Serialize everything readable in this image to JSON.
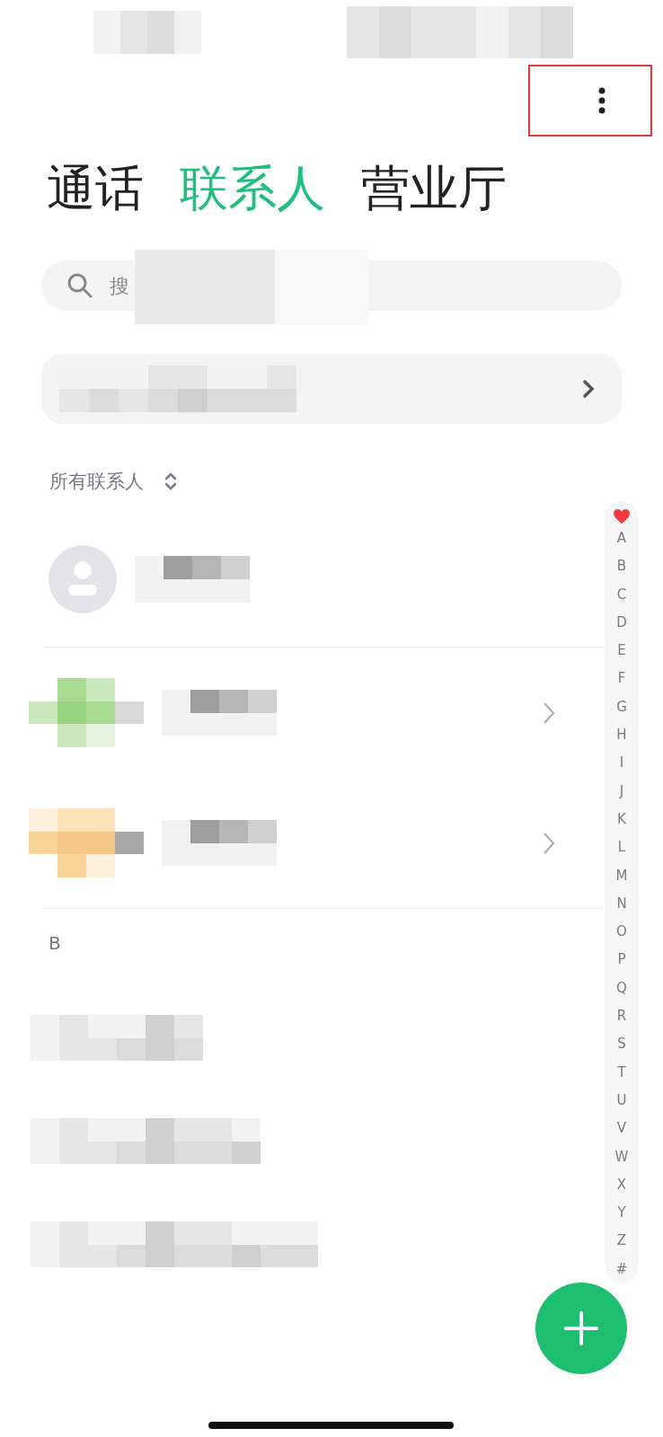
{
  "tabs": [
    {
      "label": "通话",
      "selected": false
    },
    {
      "label": "联系人",
      "selected": true
    },
    {
      "label": "营业厅",
      "selected": false
    }
  ],
  "search": {
    "placeholder": "搜"
  },
  "sort": {
    "label": "所有联系人"
  },
  "contacts": [
    {
      "kind": "placeholder",
      "chevron": false
    },
    {
      "kind": "green",
      "chevron": true
    },
    {
      "kind": "orange",
      "chevron": true
    }
  ],
  "section": "B",
  "more_contacts": [
    {
      "kind": "plain"
    },
    {
      "kind": "plain"
    },
    {
      "kind": "plain"
    }
  ],
  "index": [
    "A",
    "B",
    "C",
    "D",
    "E",
    "F",
    "G",
    "H",
    "I",
    "J",
    "K",
    "L",
    "M",
    "N",
    "O",
    "P",
    "Q",
    "R",
    "S",
    "T",
    "U",
    "V",
    "W",
    "X",
    "Y",
    "Z",
    "#"
  ]
}
